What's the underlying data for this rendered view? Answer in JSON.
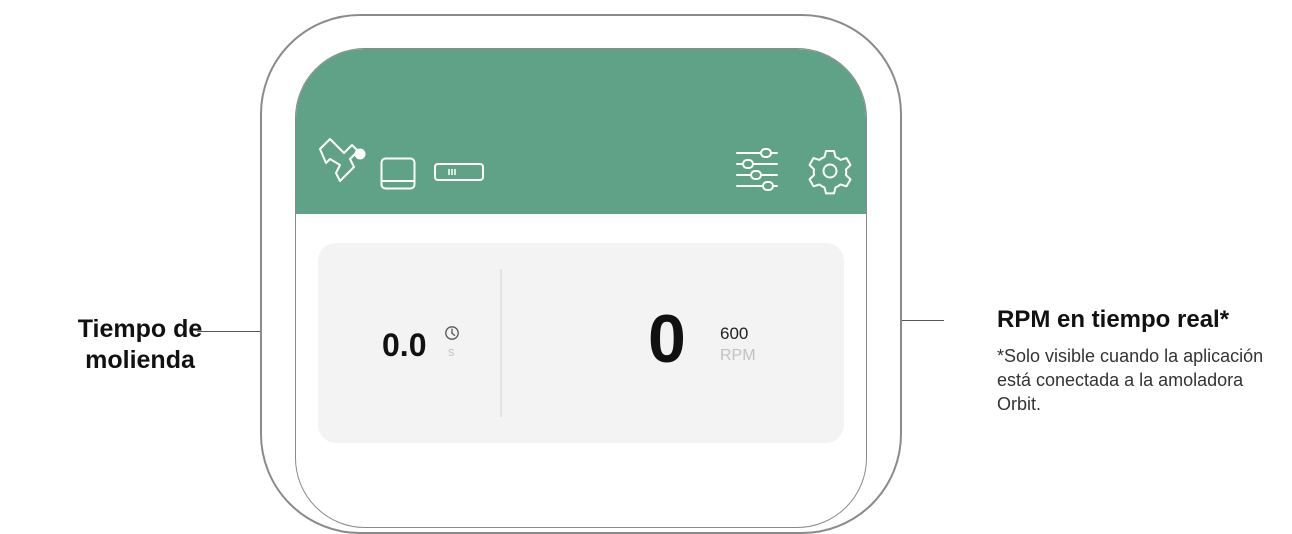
{
  "callouts": {
    "left": {
      "title": "Tiempo de molienda"
    },
    "right": {
      "title": "RPM en tiempo real*",
      "note": "*Solo visible cuando la aplicación está conectada a la amoladora Orbit."
    }
  },
  "header": {
    "background_color": "#5fa287",
    "left_icons": [
      "grinder-connected-icon",
      "container-icon",
      "battery-icon"
    ],
    "right_icons": [
      "sliders-icon",
      "gear-icon"
    ]
  },
  "panel": {
    "grind_time": {
      "value": "0.0",
      "unit": "s",
      "icon": "clock-icon"
    },
    "rpm": {
      "current": "0",
      "target": "600",
      "unit": "RPM"
    }
  }
}
